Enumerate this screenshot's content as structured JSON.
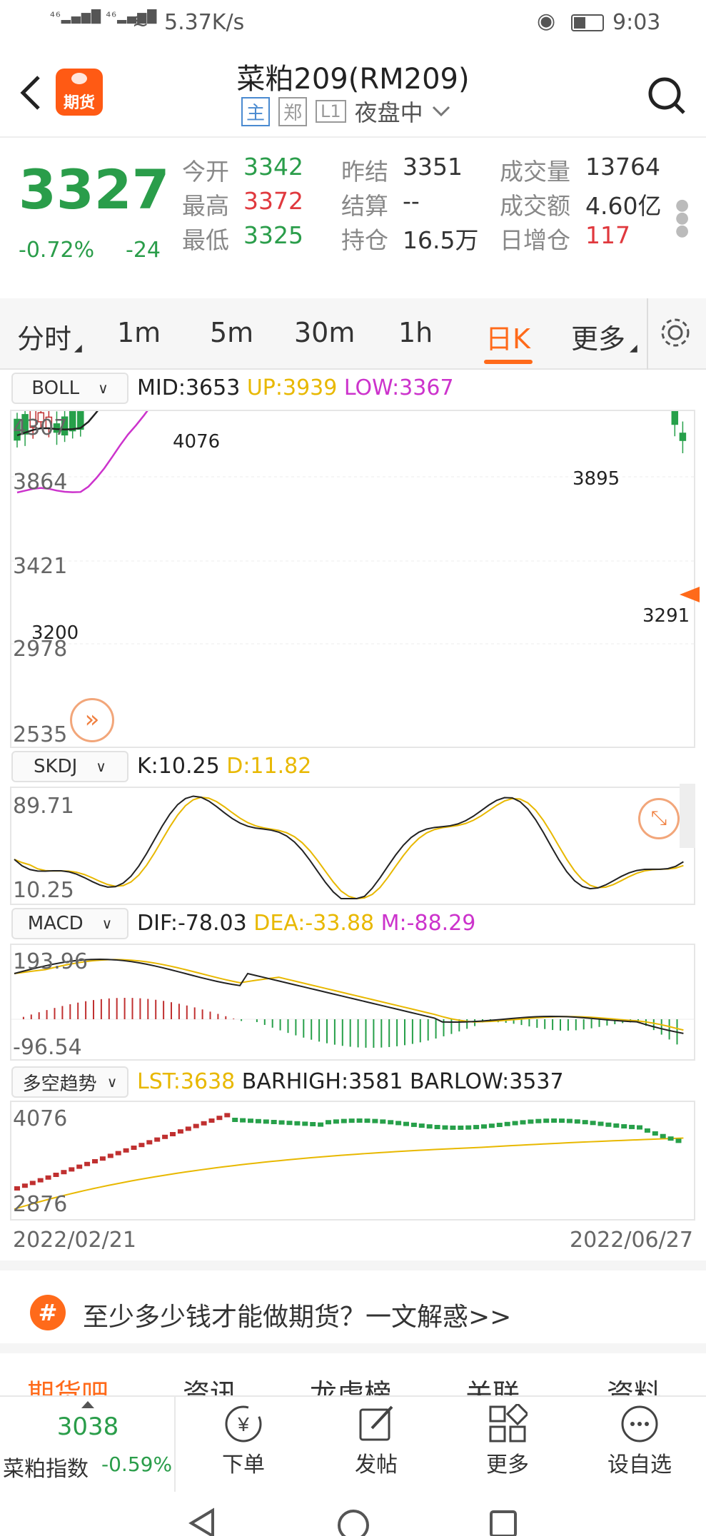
{
  "status": {
    "network": "46 46",
    "speed": "5.37K/s",
    "time": "9:03"
  },
  "header": {
    "app_icon_label": "期货",
    "title": "菜粕209(RM209)",
    "badges": [
      "主",
      "郑",
      "L1"
    ],
    "session": "夜盘中"
  },
  "quote": {
    "price": "3327",
    "change_pct": "-0.72%",
    "change": "-24",
    "fields": [
      {
        "label": "今开",
        "value": "3342",
        "color": "#2a9d4a"
      },
      {
        "label": "昨结",
        "value": "3351",
        "color": "#333333"
      },
      {
        "label": "成交量",
        "value": "13764",
        "color": "#333333"
      },
      {
        "label": "最高",
        "value": "3372",
        "color": "#e0393e"
      },
      {
        "label": "结算",
        "value": "--",
        "color": "#333333"
      },
      {
        "label": "成交额",
        "value": "4.60亿",
        "color": "#333333"
      },
      {
        "label": "最低",
        "value": "3325",
        "color": "#2a9d4a"
      },
      {
        "label": "持仓",
        "value": "16.5万",
        "color": "#333333"
      },
      {
        "label": "日增仓",
        "value": "117",
        "color": "#e0393e"
      }
    ]
  },
  "periods": {
    "tabs": [
      "分时",
      "1m",
      "5m",
      "30m",
      "1h",
      "日K",
      "更多"
    ],
    "active": "日K"
  },
  "boll": {
    "selector": "BOLL",
    "mid": "MID:3653",
    "up": "UP:3939",
    "low": "LOW:3367",
    "yticks": [
      "4307",
      "3864",
      "3421",
      "2978",
      "2535"
    ],
    "annotations": {
      "high": "4076",
      "low": "3200",
      "peak": "3895",
      "last": "3291"
    }
  },
  "skdj": {
    "selector": "SKDJ",
    "k": "K:10.25",
    "d": "D:11.82",
    "yticks": [
      "89.71",
      "10.25"
    ]
  },
  "macd": {
    "selector": "MACD",
    "dif": "DIF:-78.03",
    "dea": "DEA:-33.88",
    "m": "M:-88.29",
    "yticks": [
      "193.96",
      "-96.54"
    ]
  },
  "trend": {
    "selector": "多空趋势",
    "lst": "LST:3638",
    "barhigh": "BARHIGH:3581",
    "barlow": "BARLOW:3537",
    "yticks": [
      "4076",
      "2876"
    ]
  },
  "dates": {
    "start": "2022/02/21",
    "end": "2022/06/27"
  },
  "promo": {
    "icon": "#",
    "text": "至少多少钱才能做期货？一文解惑>>"
  },
  "content_tabs": [
    "期货吧",
    "资讯",
    "龙虎榜",
    "关联",
    "资料"
  ],
  "bottom": {
    "index_value": "3038",
    "index_name": "菜粕指数",
    "index_change": "-0.59%",
    "actions": [
      "下单",
      "发帖",
      "更多",
      "设自选"
    ]
  },
  "colors": {
    "up": "#c03030",
    "down": "#27a04a",
    "boll_up": "#e8b800",
    "boll_low": "#cc33cc",
    "accent": "#ff6a00"
  }
}
